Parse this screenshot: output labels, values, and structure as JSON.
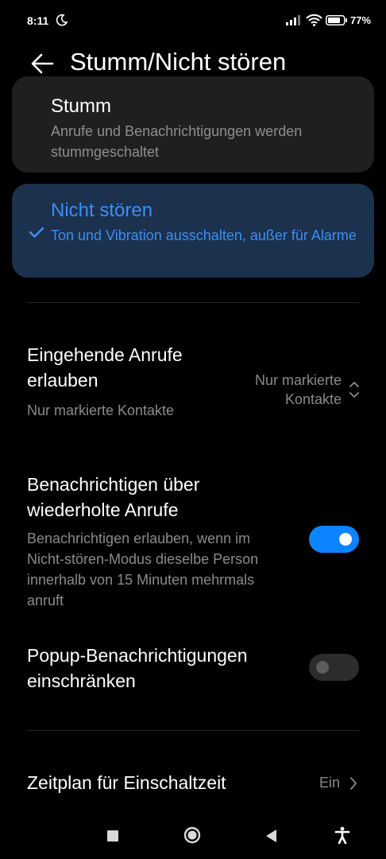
{
  "status_bar": {
    "time": "8:11",
    "battery_percent": "77"
  },
  "header": {
    "title": "Stumm/Nicht stören",
    "back_icon": "arrow-left-icon"
  },
  "modes": [
    {
      "title": "Stumm",
      "description": "Anrufe und Benachrichtigungen werden stummgeschaltet",
      "selected": false
    },
    {
      "title": "Nicht stören",
      "description": "Ton und Vibration ausschalten, außer für Alarme",
      "selected": true
    }
  ],
  "settings": {
    "incoming_calls": {
      "title": "Eingehende Anrufe erlauben",
      "subtitle": "Nur markierte Kontakte",
      "value": "Nur markierte Kontakte"
    },
    "repeated_calls": {
      "title": "Benachrichtigen über wiederholte Anrufe",
      "subtitle": "Benachrichtigen erlauben, wenn im Nicht-stören-Modus dieselbe Person innerhalb von 15 Minuten mehrmals anruft",
      "enabled": true
    },
    "popup_restrict": {
      "title": "Popup-Benachrichtigungen einschränken",
      "enabled": false
    },
    "schedule": {
      "title": "Zeitplan für Einschaltzeit",
      "value": "Ein"
    }
  },
  "colors": {
    "accent": "#0d84ff",
    "selected_card": "#1c314d",
    "card": "#1f1f1f",
    "background": "#000000"
  }
}
